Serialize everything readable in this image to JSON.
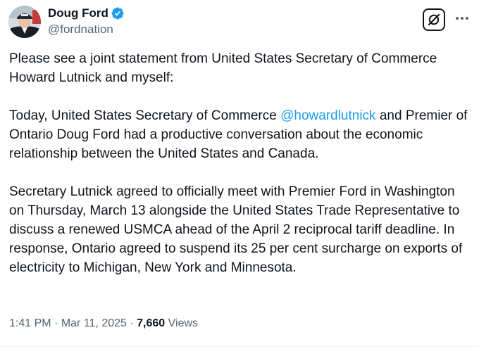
{
  "author": {
    "display_name": "Doug Ford",
    "handle": "@fordnation",
    "verified_color": "#1d9bf0"
  },
  "icons": {
    "grok": "grok-icon",
    "more": "more-icon",
    "verified": "verified-badge-icon"
  },
  "tweet": {
    "para1": "Please see a joint statement from United States Secretary of Commerce Howard Lutnick and myself:",
    "para2_before": "Today, United States Secretary of Commerce ",
    "mention": "@howardlutnick",
    "para2_after": " and Premier of Ontario Doug Ford had a productive conversation about the economic relationship between the United States and Canada.",
    "para3": "Secretary Lutnick agreed to officially meet with Premier Ford in Washington on Thursday, March 13 alongside the United States Trade Representative to discuss a renewed USMCA ahead of the April 2 reciprocal tariff deadline. In response, Ontario agreed to suspend its 25 per cent surcharge on exports of electricity to Michigan, New York and Minnesota."
  },
  "meta": {
    "time": "1:41 PM",
    "date": "Mar 11, 2025",
    "views_count": "7,660",
    "views_label": "Views",
    "separator": " · "
  }
}
